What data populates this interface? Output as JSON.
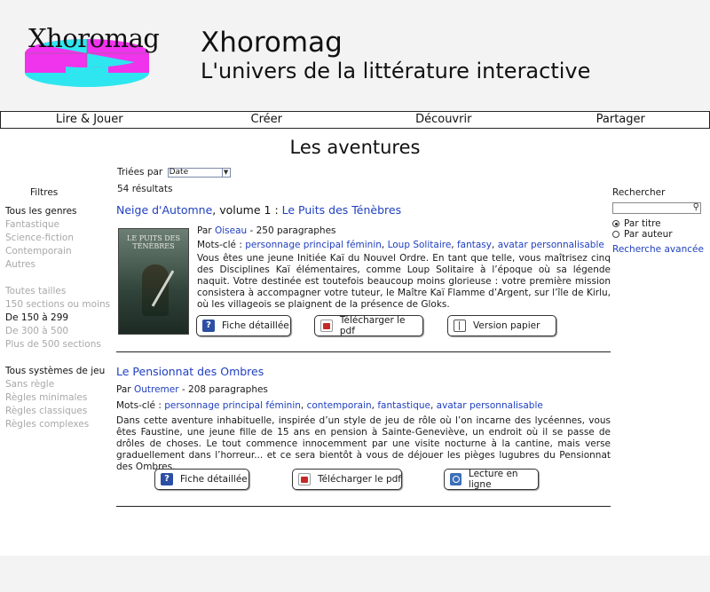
{
  "header": {
    "logo_text": "Xhoromag",
    "site_title": "Xhoromag",
    "site_subtitle": "L'univers de la littérature interactive"
  },
  "nav": [
    "Lire & Jouer",
    "Créer",
    "Découvrir",
    "Partager"
  ],
  "page_title": "Les aventures",
  "sort": {
    "label": "Triées par",
    "selected": "Date"
  },
  "result_count": "54 résultats",
  "filters": {
    "title": "Filtres",
    "genres": [
      "Tous les genres",
      "Fantastique",
      "Science-fiction",
      "Contemporain",
      "Autres"
    ],
    "sizes": [
      "Toutes tailles",
      "150 sections ou moins",
      "De 150 à 299",
      "De 300 à 500",
      "Plus de 500 sections"
    ],
    "systems": [
      "Tous systèmes de jeu",
      "Sans règle",
      "Règles minimales",
      "Règles classiques",
      "Règles complexes"
    ]
  },
  "search": {
    "title": "Rechercher",
    "by_title": "Par titre",
    "by_author": "Par auteur",
    "advanced": "Recherche avancée"
  },
  "results": [
    {
      "series": "Neige d'Automne",
      "volume": ", volume 1 : ",
      "title": "Le Puits des Ténèbres",
      "by": "Par ",
      "author": "Oiseau",
      "paragraphs": " - 250 paragraphes",
      "keywords_label": "Mots-clé : ",
      "keywords": [
        "personnage principal féminin",
        "Loup Solitaire",
        "fantasy",
        "avatar personnalisable"
      ],
      "description": "Vous êtes une jeune Initiée Kaï du Nouvel Ordre. En tant que telle, vous maîtrisez cinq des Disciplines Kaï élémentaires, comme Loup Solitaire à l’époque où sa légende naquit. Votre destinée est toutefois beaucoup moins glorieuse : votre première mission consistera à accompagner votre tuteur, le Maître Kaï Flamme d’Argent, sur l’île de Kirlu, où les villageois se plaignent de la présence de Gloks.",
      "cover_title": "LE PUITS DES TÉNÈBRES",
      "buttons": [
        "Fiche détaillée",
        "Télécharger le pdf",
        "Version papier"
      ]
    },
    {
      "title": "Le Pensionnat des Ombres",
      "by": "Par ",
      "author": "Outremer",
      "paragraphs": " - 208 paragraphes",
      "keywords_label": "Mots-clé : ",
      "keywords": [
        "personnage principal féminin",
        "contemporain",
        "fantastique",
        "avatar personnalisable"
      ],
      "description": "Dans cette aventure inhabituelle, inspirée d’un style de jeu de rôle où l’on incarne des lycéennes, vous êtes Faustine, une jeune fille de 15 ans en pension à Sainte-Geneviève, un endroit où il se passe de drôles de choses. Le tout commence innocemment par une visite nocturne à la cantine, mais verse graduellement dans l’horreur... et ce sera bientôt à vous de déjouer les pièges lugubres du Pensionnat des Ombres.",
      "buttons": [
        "Fiche détaillée",
        "Télécharger le pdf",
        "Lecture en ligne"
      ]
    }
  ],
  "colors": {
    "link": "#1f3fbf",
    "header_bg": "#f3f3f3",
    "logo_magenta": "#f033ec",
    "logo_cyan": "#2ee6ef"
  },
  "icons": {
    "info": "info-icon",
    "pdf": "pdf-icon",
    "book": "book-icon",
    "web": "web-icon",
    "search": "search-icon"
  }
}
